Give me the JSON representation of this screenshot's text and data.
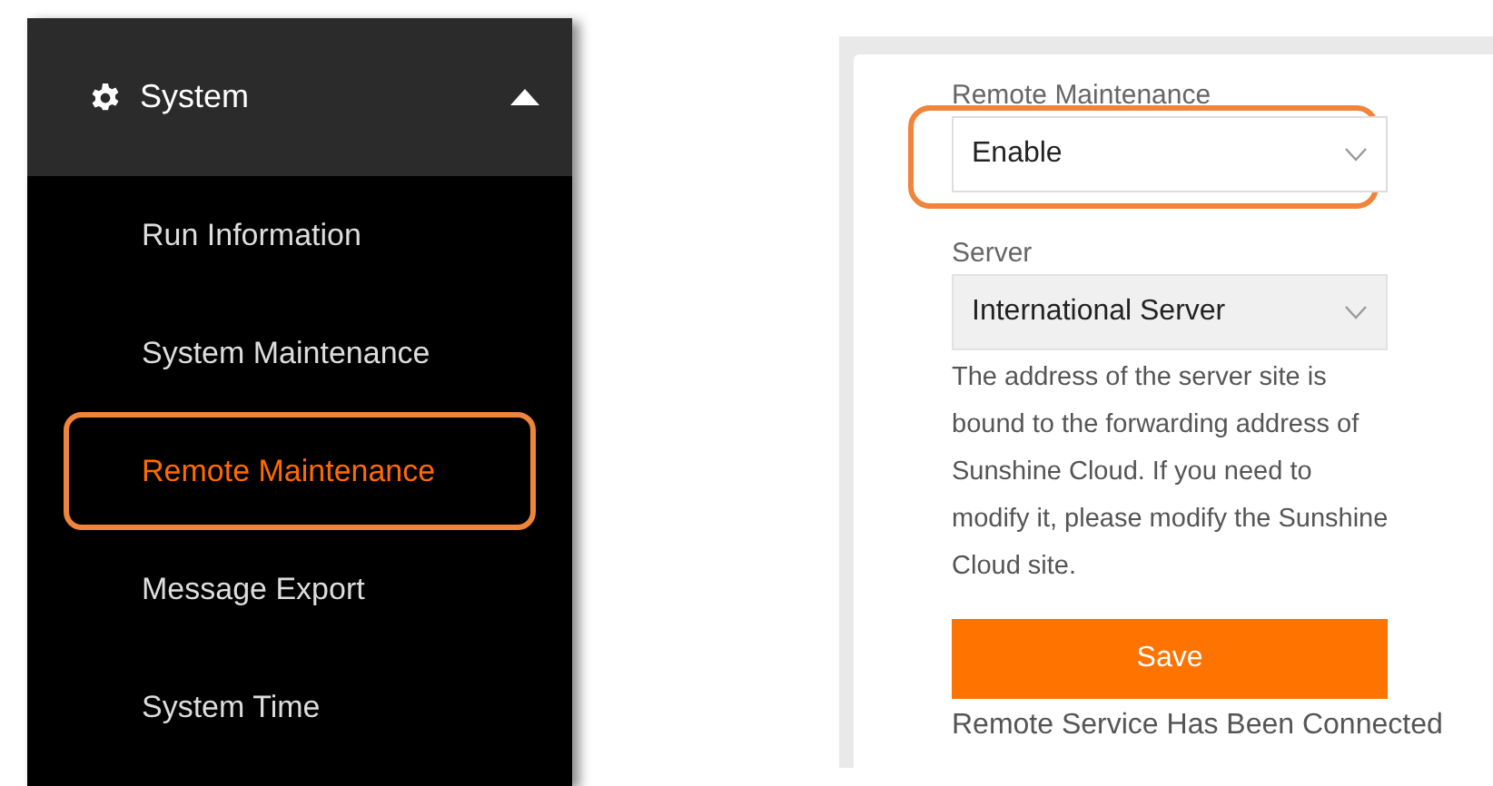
{
  "sidebar": {
    "header": {
      "label": "System",
      "expanded": true
    },
    "items": [
      {
        "label": "Run Information",
        "selected": false,
        "highlighted": false
      },
      {
        "label": "System Maintenance",
        "selected": false,
        "highlighted": false
      },
      {
        "label": "Remote Maintenance",
        "selected": true,
        "highlighted": true
      },
      {
        "label": "Message Export",
        "selected": false,
        "highlighted": false
      },
      {
        "label": "System Time",
        "selected": false,
        "highlighted": false
      }
    ]
  },
  "form": {
    "fields": [
      {
        "label": "Remote Maintenance",
        "value": "Enable",
        "disabled": false,
        "highlighted": true
      },
      {
        "label": "Server",
        "value": "International Server",
        "disabled": true,
        "highlighted": false
      }
    ],
    "hint": "The address of the server site is bound to the forwarding address of Sunshine Cloud. If you need to modify it, please modify the Sunshine Cloud site.",
    "save_button": "Save",
    "status": "Remote Service Has Been Connected"
  }
}
